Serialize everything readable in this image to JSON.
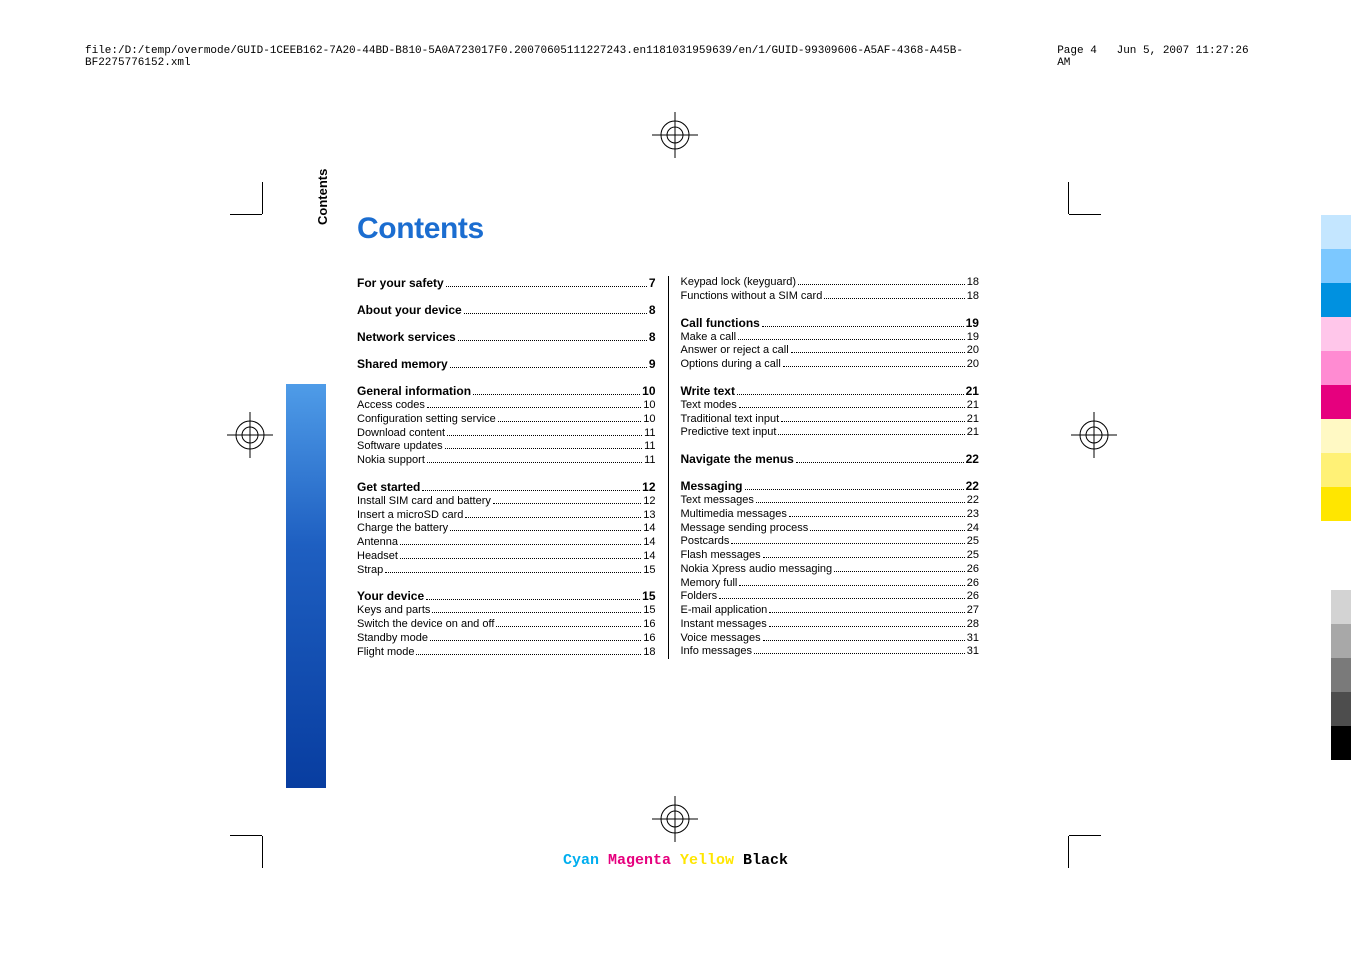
{
  "meta": {
    "path": "file:/D:/temp/overmode/GUID-1CEEB162-7A20-44BD-B810-5A0A723017F0.20070605111227243.en1181031959639/en/1/GUID-99309606-A5AF-4368-A45B-BF2275776152.xml",
    "page": "Page  4",
    "timestamp": "Jun 5, 2007 11:27:26 AM"
  },
  "side_tab": "Contents",
  "title": "Contents",
  "left_col": [
    {
      "head": true,
      "label": "For your safety ",
      "page": "7",
      "solo": true
    },
    {
      "head": true,
      "label": "About your device",
      "page": "8",
      "solo": true
    },
    {
      "head": true,
      "label": "Network services",
      "page": "8",
      "solo": true
    },
    {
      "head": true,
      "label": "Shared memory",
      "page": "9",
      "solo": true
    },
    {
      "head": true,
      "label": "General information",
      "page": "10"
    },
    {
      "label": "Access codes",
      "page": "10"
    },
    {
      "label": "Configuration setting service",
      "page": "10"
    },
    {
      "label": "Download content",
      "page": "11"
    },
    {
      "label": "Software updates",
      "page": "11"
    },
    {
      "label": "Nokia support",
      "page": "11",
      "last": true
    },
    {
      "head": true,
      "label": "Get started",
      "page": "12"
    },
    {
      "label": "Install SIM card and battery",
      "page": "12"
    },
    {
      "label": "Insert a microSD card",
      "page": "13"
    },
    {
      "label": "Charge the battery",
      "page": "14"
    },
    {
      "label": "Antenna",
      "page": "14"
    },
    {
      "label": "Headset",
      "page": "14"
    },
    {
      "label": "Strap",
      "page": "15",
      "last": true
    },
    {
      "head": true,
      "label": "Your device",
      "page": "15"
    },
    {
      "label": "Keys and parts",
      "page": "15"
    },
    {
      "label": "Switch the device on and off",
      "page": "16"
    },
    {
      "label": "Standby mode",
      "page": "16"
    },
    {
      "label": "Flight mode",
      "page": "18"
    }
  ],
  "right_col": [
    {
      "label": "Keypad lock (keyguard)",
      "page": "18"
    },
    {
      "label": "Functions without a SIM card",
      "page": "18",
      "last": true
    },
    {
      "head": true,
      "label": "Call functions",
      "page": "19"
    },
    {
      "label": "Make a call",
      "page": "19"
    },
    {
      "label": "Answer or reject a call",
      "page": "20"
    },
    {
      "label": "Options during a call",
      "page": "20",
      "last": true
    },
    {
      "head": true,
      "label": "Write text",
      "page": "21"
    },
    {
      "label": "Text modes",
      "page": "21"
    },
    {
      "label": "Traditional text input",
      "page": "21"
    },
    {
      "label": "Predictive text input",
      "page": "21",
      "last": true
    },
    {
      "head": true,
      "label": "Navigate the menus",
      "page": "22",
      "solo": true
    },
    {
      "head": true,
      "label": "Messaging",
      "page": "22"
    },
    {
      "label": "Text messages",
      "page": "22"
    },
    {
      "label": "Multimedia messages",
      "page": "23"
    },
    {
      "label": "Message sending process",
      "page": "24"
    },
    {
      "label": "Postcards",
      "page": "25"
    },
    {
      "label": "Flash messages",
      "page": "25"
    },
    {
      "label": "Nokia Xpress audio messaging",
      "page": "26"
    },
    {
      "label": "Memory full",
      "page": "26"
    },
    {
      "label": "Folders",
      "page": "26"
    },
    {
      "label": "E-mail application",
      "page": "27"
    },
    {
      "label": "Instant messages",
      "page": "28"
    },
    {
      "label": "Voice messages",
      "page": "31"
    },
    {
      "label": "Info messages",
      "page": "31"
    }
  ],
  "footer": {
    "c": "Cyan",
    "m": "Magenta",
    "y": "Yellow",
    "k": "Black"
  }
}
